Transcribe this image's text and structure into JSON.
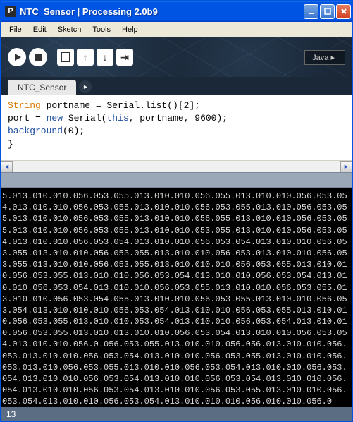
{
  "titlebar": {
    "icon_letter": "P",
    "title": "NTC_Sensor | Processing 2.0b9"
  },
  "menubar": {
    "items": [
      "File",
      "Edit",
      "Sketch",
      "Tools",
      "Help"
    ]
  },
  "toolbar": {
    "lang": "Java ▸"
  },
  "tab": {
    "name": "NTC_Sensor"
  },
  "code": {
    "line1_type": "String",
    "line1_rest": " portname = Serial.list()[2];",
    "line2_a": "  port = ",
    "line2_new": "new",
    "line2_b": " Serial(",
    "line2_this": "this",
    "line2_c": ", portname, 9600);",
    "line3_fn": "  background",
    "line3_rest": "(0);",
    "line4": "",
    "line5": "}"
  },
  "console": {
    "text": "5.013.010.010.056.053.055.013.010.010.056.055.013.010.010.056.053.054.013.010.010.056.053.055.013.010.010.056.053.055.013.010.056.053.055.013.010.010.056.053.055.013.010.010.056.055.013.010.010.056.053.055.013.010.010.056.053.055.013.010.010.053.055.013.010.010.056.053.054.013.010.010.056.053.054.013.010.010.056.053.054.013.010.010.056.053.055.013.010.010.056.053.055.013.010.010.056.053.013.010.010.056.053.055.013.010.010.056.053.055.013.010.010.010.056.053.055.013.010.010.056.053.055.013.010.010.056.053.054.013.010.010.056.053.054.013.010.010.056.053.054.013.010.010.056.053.055.013.010.010.056.053.055.013.010.010.056.053.054.055.013.010.010.056.053.055.013.010.010.056.053.054.013.010.010.010.056.053.054.013.010.010.056.053.055.013.010.010.056.053.055.013.010.010.053.054.013.010.010.056.053.054.013.010.010.056.053.055.013.010.013.010.010.056.053.054.013.010.010.056.053.054.013.010.010.056.0.056.053.055.013.010.010.056.056.013.010.010.056.053.013.010.010.056.053.054.013.010.010.056.053.055.013.010.010.056.053.013.010.056.053.055.013.010.010.056.053.054.013.010.010.056.053.054.013.010.010.056.053.054.013.010.010.056.053.054.013.010.010.056.054.013.010.010.056.053.054.013.010.010.056.053.055.013.010.010.056.053.054.013.010.010.056.053.054.013.010.010.010.056.010.010.056.0"
  },
  "status": {
    "line_number": "13"
  }
}
